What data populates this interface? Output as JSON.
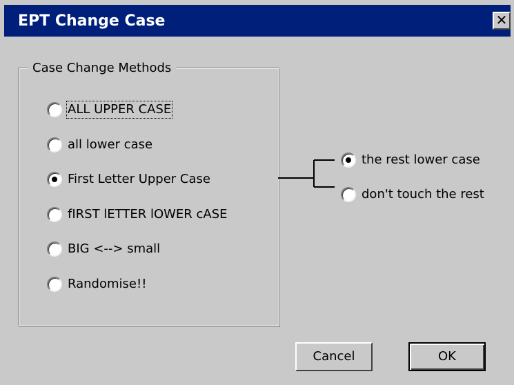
{
  "window": {
    "title": "EPT Change Case",
    "close_glyph": "✕"
  },
  "methods": {
    "group_label": "Case Change Methods",
    "options": [
      {
        "label": "ALL UPPER CASE",
        "checked": false,
        "focused": true
      },
      {
        "label": "all lower case",
        "checked": false,
        "focused": false
      },
      {
        "label": "First Letter Upper Case",
        "checked": true,
        "focused": false
      },
      {
        "label": "fIRST lETTER lOWER cASE",
        "checked": false,
        "focused": false
      },
      {
        "label": "BIG <--> small",
        "checked": false,
        "focused": false
      },
      {
        "label": "Randomise!!",
        "checked": false,
        "focused": false
      }
    ]
  },
  "suboptions": {
    "options": [
      {
        "label": "the rest lower case",
        "checked": true
      },
      {
        "label": "don't touch the rest",
        "checked": false
      }
    ]
  },
  "buttons": {
    "cancel_label": "Cancel",
    "ok_label": "OK"
  },
  "colors": {
    "titlebar": "#001f7a",
    "dialog_bg": "#c9c9c9"
  }
}
